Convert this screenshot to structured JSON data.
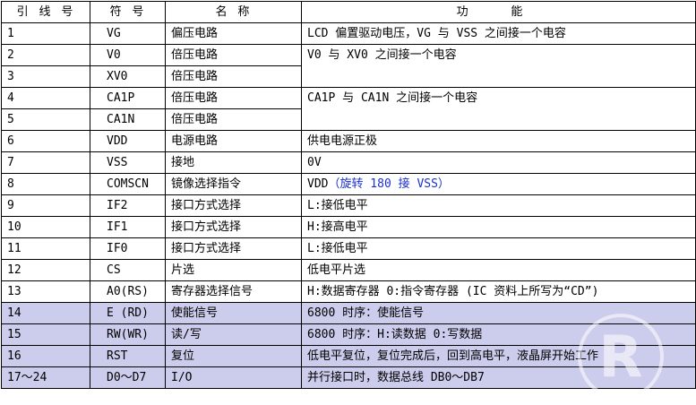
{
  "headers": [
    "引 线 号",
    "符 号",
    "名 称",
    "功 能"
  ],
  "rows": [
    {
      "pin": "1",
      "symbol": "VG",
      "name": "偏压电路",
      "function": "LCD 偏置驱动电压，VG 与 VSS 之间接一个电容"
    },
    {
      "pin": "2",
      "symbol": "V0",
      "name": "倍压电路",
      "function": "V0 与 XV0 之间接一个电容"
    },
    {
      "pin": "3",
      "symbol": "XV0",
      "name": "倍压电路",
      "function": ""
    },
    {
      "pin": "4",
      "symbol": "CA1P",
      "name": "倍压电路",
      "function": "CA1P 与 CA1N 之间接一个电容"
    },
    {
      "pin": "5",
      "symbol": "CA1N",
      "name": "倍压电路",
      "function": ""
    },
    {
      "pin": "6",
      "symbol": "VDD",
      "name": "电源电路",
      "function": "供电电源正极"
    },
    {
      "pin": "7",
      "symbol": "VSS",
      "name": "接地",
      "function": "0V"
    },
    {
      "pin": "8",
      "symbol": "COMSCN",
      "name": "镜像选择指令",
      "function": "VDD",
      "function_note": "（旋转 180 接 VSS）"
    },
    {
      "pin": "9",
      "symbol": "IF2",
      "name": "接口方式选择",
      "function": "L:接低电平"
    },
    {
      "pin": "10",
      "symbol": "IF1",
      "name": "接口方式选择",
      "function": "H:接高电平"
    },
    {
      "pin": "11",
      "symbol": "IF0",
      "name": "接口方式选择",
      "function": "L:接低电平"
    },
    {
      "pin": "12",
      "symbol": "CS",
      "name": "片选",
      "function": "低电平片选"
    },
    {
      "pin": "13",
      "symbol": "A0(RS)",
      "name": "寄存器选择信号",
      "function": "H:数据寄存器 0:指令寄存器 (IC 资料上所写为“CD”)"
    },
    {
      "pin": "14",
      "symbol": "E (RD)",
      "name": "使能信号",
      "function": "6800 时序：使能信号"
    },
    {
      "pin": "15",
      "symbol": "RW(WR)",
      "name": "读/写",
      "function": "6800 时序：H:读数据   0:写数据"
    },
    {
      "pin": "16",
      "symbol": "RST",
      "name": "复位",
      "function": "低电平复位，复位完成后，回到高电平，液晶屏开始工作"
    },
    {
      "pin": "17～24",
      "symbol": "D0～D7",
      "name": "I/O",
      "function": "并行接口时，数据总线 DB0～DB7"
    }
  ],
  "watermark": {
    "glyph": "R"
  },
  "colors": {
    "shade": "#ccccec",
    "note": "#1a2fd0"
  }
}
